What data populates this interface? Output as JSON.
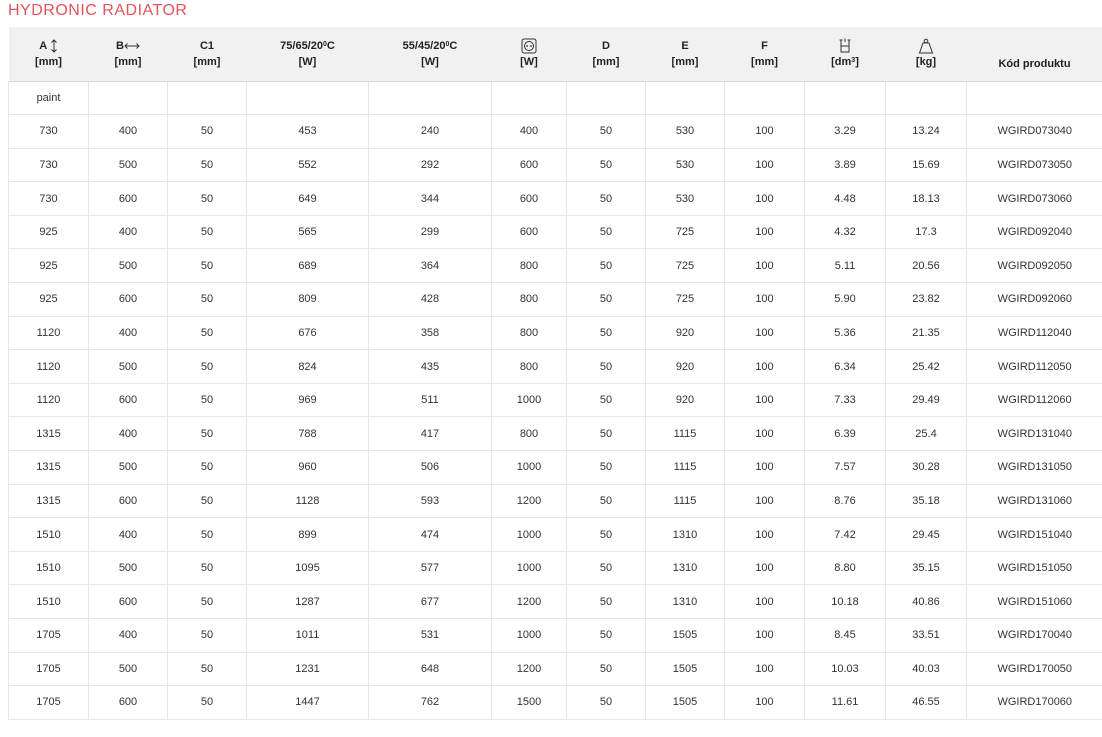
{
  "title": "HYDRONIC RADIATOR",
  "columns": [
    {
      "label": "A",
      "icon": "height-arrow-icon",
      "unit": "[mm]"
    },
    {
      "label": "B",
      "icon": "width-arrow-icon",
      "unit": "[mm]"
    },
    {
      "label": "C1",
      "unit": "[mm]"
    },
    {
      "label": "75/65/20",
      "deg": "0",
      "c": "C",
      "unit": "[W]"
    },
    {
      "label": "55/45/20",
      "deg": "0",
      "c": "C",
      "unit": "[W]"
    },
    {
      "icon": "socket-icon",
      "unit": "[W]"
    },
    {
      "label": "D",
      "unit": "[mm]"
    },
    {
      "label": "E",
      "unit": "[mm]"
    },
    {
      "label": "F",
      "unit": "[mm]"
    },
    {
      "icon": "water-volume-icon",
      "unit_pre": "[dm",
      "unit_sup": "3",
      "unit_post": "]"
    },
    {
      "icon": "weight-icon",
      "unit": "[kg]"
    },
    {
      "label": "Kód produktu"
    }
  ],
  "rows": [
    [
      "paint",
      "",
      "",
      "",
      "",
      "",
      "",
      "",
      "",
      "",
      "",
      ""
    ],
    [
      "730",
      "400",
      "50",
      "453",
      "240",
      "400",
      "50",
      "530",
      "100",
      "3.29",
      "13.24",
      "WGIRD073040"
    ],
    [
      "730",
      "500",
      "50",
      "552",
      "292",
      "600",
      "50",
      "530",
      "100",
      "3.89",
      "15.69",
      "WGIRD073050"
    ],
    [
      "730",
      "600",
      "50",
      "649",
      "344",
      "600",
      "50",
      "530",
      "100",
      "4.48",
      "18.13",
      "WGIRD073060"
    ],
    [
      "925",
      "400",
      "50",
      "565",
      "299",
      "600",
      "50",
      "725",
      "100",
      "4.32",
      "17.3",
      "WGIRD092040"
    ],
    [
      "925",
      "500",
      "50",
      "689",
      "364",
      "800",
      "50",
      "725",
      "100",
      "5.11",
      "20.56",
      "WGIRD092050"
    ],
    [
      "925",
      "600",
      "50",
      "809",
      "428",
      "800",
      "50",
      "725",
      "100",
      "5.90",
      "23.82",
      "WGIRD092060"
    ],
    [
      "1120",
      "400",
      "50",
      "676",
      "358",
      "800",
      "50",
      "920",
      "100",
      "5.36",
      "21.35",
      "WGIRD112040"
    ],
    [
      "1120",
      "500",
      "50",
      "824",
      "435",
      "800",
      "50",
      "920",
      "100",
      "6.34",
      "25.42",
      "WGIRD112050"
    ],
    [
      "1120",
      "600",
      "50",
      "969",
      "511",
      "1000",
      "50",
      "920",
      "100",
      "7.33",
      "29.49",
      "WGIRD112060"
    ],
    [
      "1315",
      "400",
      "50",
      "788",
      "417",
      "800",
      "50",
      "1115",
      "100",
      "6.39",
      "25.4",
      "WGIRD131040"
    ],
    [
      "1315",
      "500",
      "50",
      "960",
      "506",
      "1000",
      "50",
      "1115",
      "100",
      "7.57",
      "30.28",
      "WGIRD131050"
    ],
    [
      "1315",
      "600",
      "50",
      "1128",
      "593",
      "1200",
      "50",
      "1115",
      "100",
      "8.76",
      "35.18",
      "WGIRD131060"
    ],
    [
      "1510",
      "400",
      "50",
      "899",
      "474",
      "1000",
      "50",
      "1310",
      "100",
      "7.42",
      "29.45",
      "WGIRD151040"
    ],
    [
      "1510",
      "500",
      "50",
      "1095",
      "577",
      "1000",
      "50",
      "1310",
      "100",
      "8.80",
      "35.15",
      "WGIRD151050"
    ],
    [
      "1510",
      "600",
      "50",
      "1287",
      "677",
      "1200",
      "50",
      "1310",
      "100",
      "10.18",
      "40.86",
      "WGIRD151060"
    ],
    [
      "1705",
      "400",
      "50",
      "1011",
      "531",
      "1000",
      "50",
      "1505",
      "100",
      "8.45",
      "33.51",
      "WGIRD170040"
    ],
    [
      "1705",
      "500",
      "50",
      "1231",
      "648",
      "1200",
      "50",
      "1505",
      "100",
      "10.03",
      "40.03",
      "WGIRD170050"
    ],
    [
      "1705",
      "600",
      "50",
      "1447",
      "762",
      "1500",
      "50",
      "1505",
      "100",
      "11.61",
      "46.55",
      "WGIRD170060"
    ]
  ],
  "colors": {
    "title": "#e5535b",
    "header_bg": "#f1f1f1",
    "border": "#e6e6e6"
  }
}
